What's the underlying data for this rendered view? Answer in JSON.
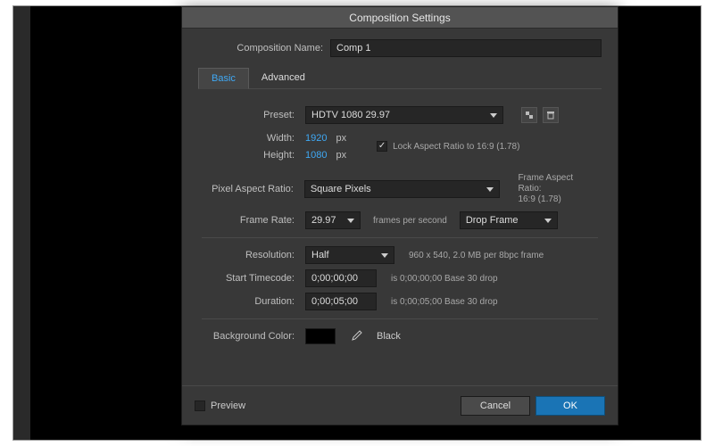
{
  "dialog": {
    "title": "Composition Settings",
    "comp_name_label": "Composition Name:",
    "comp_name_value": "Comp 1"
  },
  "tabs": {
    "basic": "Basic",
    "advanced": "Advanced"
  },
  "preset": {
    "label": "Preset:",
    "value": "HDTV 1080 29.97"
  },
  "dims": {
    "width_label": "Width:",
    "width_value": "1920",
    "height_label": "Height:",
    "height_value": "1080",
    "px": "px",
    "lock_label": "Lock Aspect Ratio to 16:9 (1.78)"
  },
  "par": {
    "label": "Pixel Aspect Ratio:",
    "value": "Square Pixels",
    "frame_ratio_label": "Frame Aspect Ratio:",
    "frame_ratio_value": "16:9 (1.78)"
  },
  "fps": {
    "label": "Frame Rate:",
    "value": "29.97",
    "suffix": "frames per second",
    "drop_value": "Drop Frame"
  },
  "res": {
    "label": "Resolution:",
    "value": "Half",
    "info": "960 x 540, 2.0 MB per 8bpc frame"
  },
  "tc": {
    "start_label": "Start Timecode:",
    "start_value": "0;00;00;00",
    "start_info": "is 0;00;00;00 Base 30  drop",
    "dur_label": "Duration:",
    "dur_value": "0;00;05;00",
    "dur_info": "is 0;00;05;00  Base 30  drop"
  },
  "bg": {
    "label": "Background Color:",
    "name": "Black"
  },
  "footer": {
    "preview": "Preview",
    "cancel": "Cancel",
    "ok": "OK"
  }
}
